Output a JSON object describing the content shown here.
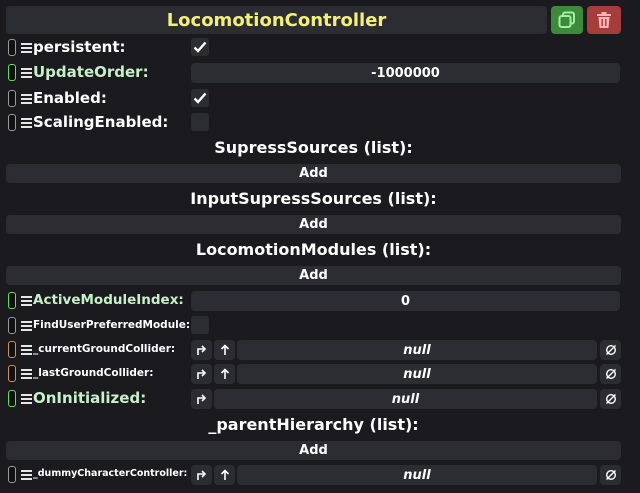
{
  "header": {
    "title": "LocomotionController"
  },
  "fields": {
    "persistent": {
      "label": "persistent:"
    },
    "update_order": {
      "label": "UpdateOrder:",
      "value": "-1000000"
    },
    "enabled": {
      "label": "Enabled:"
    },
    "scaling_enabled": {
      "label": "ScalingEnabled:"
    },
    "active_module_index": {
      "label": "ActiveModuleIndex:",
      "value": "0"
    },
    "find_user_preferred_module": {
      "label": "FindUserPreferredModule:"
    },
    "current_ground_collider": {
      "label": "_currentGroundCollider:",
      "value": "null"
    },
    "last_ground_collider": {
      "label": "_lastGroundCollider:",
      "value": "null"
    },
    "on_initialized": {
      "label": "OnInitialized:",
      "value": "null"
    },
    "dummy_character_controller": {
      "label": "_dummyCharacterController:",
      "value": "null"
    }
  },
  "lists": {
    "supress_sources": {
      "title": "SupressSources (list):",
      "add_label": "Add"
    },
    "input_supress_sources": {
      "title": "InputSupressSources (list):",
      "add_label": "Add"
    },
    "locomotion_modules": {
      "title": "LocomotionModules (list):",
      "add_label": "Add"
    },
    "parent_hierarchy": {
      "title": "_parentHierarchy (list):",
      "add_label": "Add"
    }
  },
  "colors": {
    "title": "#f3f07a",
    "duplicate_button": "#3d8a3d",
    "delete_button": "#a53d3d",
    "panel": "#2c2c33",
    "background": "#1b1b1f"
  },
  "icons": {
    "duplicate": "duplicate-icon",
    "delete": "trash-icon",
    "check": "check-icon",
    "drive": "arrow-turn-up-icon",
    "jump": "arrow-up-icon",
    "clear": "null-clear-icon",
    "menu": "hamburger-icon"
  }
}
